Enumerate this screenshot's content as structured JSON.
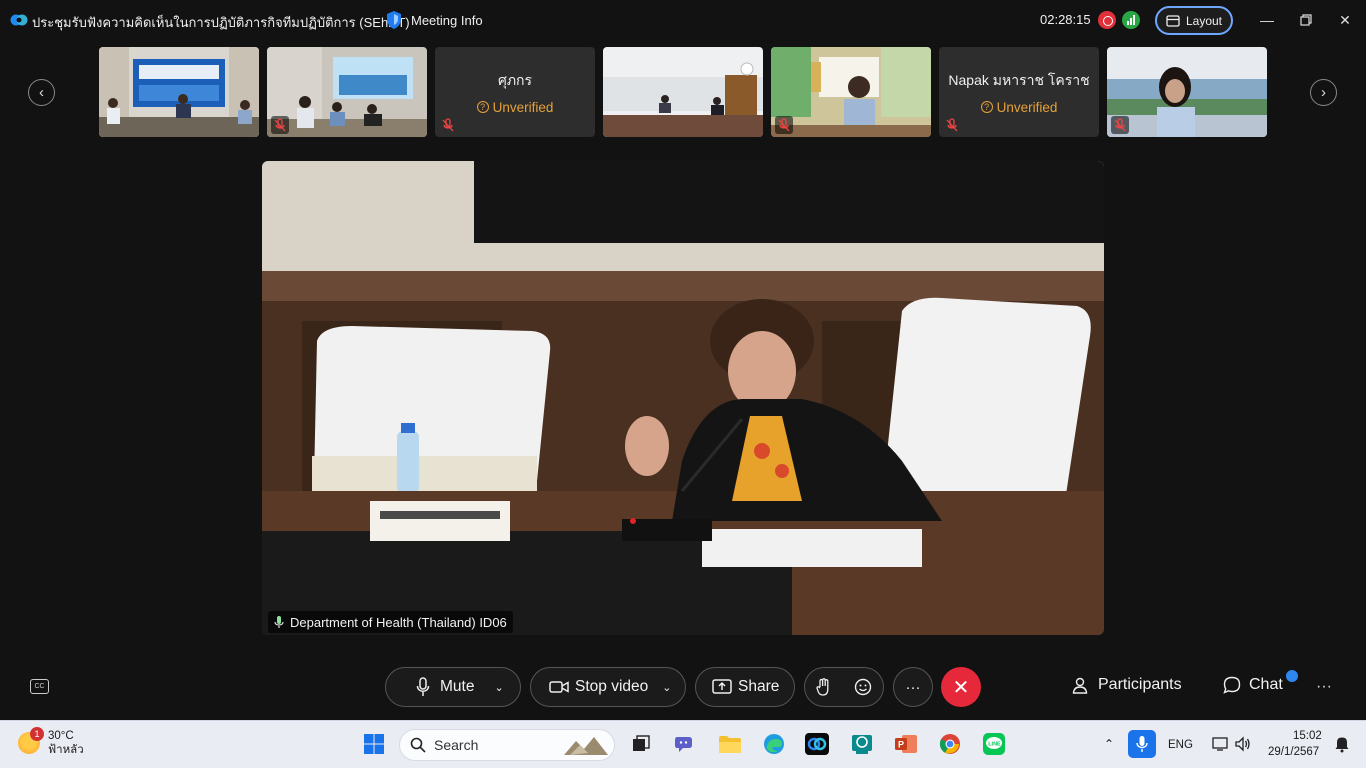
{
  "window": {
    "meeting_title": "ประชุมรับฟังความคิดเห็นในการปฏิบัติภารกิจทีมปฏิบัติการ (SEhRT)",
    "meeting_info_label": "Meeting Info",
    "timer": "02:28:15",
    "layout_label": "Layout"
  },
  "participants_strip": [
    {
      "type": "video",
      "muted": false
    },
    {
      "type": "video",
      "muted": true
    },
    {
      "type": "name",
      "name": "ศุภกร",
      "status": "Unverified",
      "muted": true
    },
    {
      "type": "video",
      "muted": false
    },
    {
      "type": "video",
      "muted": true
    },
    {
      "type": "name",
      "name": "Napak มหาราช โคราช",
      "status": "Unverified",
      "muted": true
    },
    {
      "type": "video",
      "muted": true
    }
  ],
  "main_video": {
    "speaker_label": "Department of Health (Thailand) ID06"
  },
  "controls": {
    "mute_label": "Mute",
    "stop_video_label": "Stop video",
    "share_label": "Share",
    "participants_label": "Participants",
    "chat_label": "Chat",
    "more_label": "···",
    "cc_label": "CC"
  },
  "taskbar": {
    "weather_temp": "30°C",
    "weather_desc": "ฟ้าหลัว",
    "weather_badge": "1",
    "search_label": "Search",
    "language": "ENG",
    "time": "15:02",
    "date": "29/1/2567"
  },
  "colors": {
    "accent_blue": "#2f86f0",
    "end_red": "#e5283a",
    "unverified": "#e5a13a",
    "record": "#e0303a",
    "signal": "#2aa745"
  }
}
